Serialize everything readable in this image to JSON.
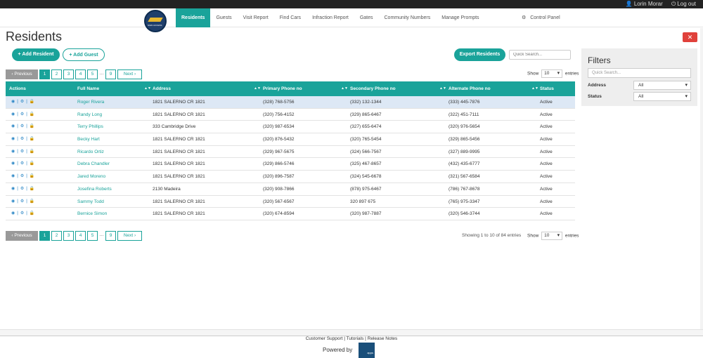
{
  "topbar": {
    "user": "Lorin Morar",
    "logout": "Log out"
  },
  "logo_text": "SIGN ACCESS",
  "nav": {
    "items": [
      "Residents",
      "Guests",
      "Visit Report",
      "Find Cars",
      "Infraction Report",
      "Gates",
      "Community Numbers",
      "Manage Prompts"
    ],
    "active": "Residents",
    "control_panel": "Control Panel"
  },
  "page": {
    "title": "Residents",
    "close": "✕"
  },
  "buttons": {
    "add_resident": "+ Add Resident",
    "add_guest": "+ Add Guest",
    "export": "Export Residents"
  },
  "search": {
    "placeholder": "Quick Search..."
  },
  "pagination": {
    "prev": "‹ Previous",
    "pages": [
      "1",
      "2",
      "3",
      "4",
      "5",
      "…",
      "9"
    ],
    "next": "Next ›",
    "current": "1"
  },
  "show": {
    "label": "Show",
    "value": "10",
    "suffix": "entries"
  },
  "table": {
    "headers": [
      "Actions",
      "Full Name",
      "Address",
      "Primary Phone no",
      "Secondary Phone no",
      "Alternate Phone no",
      "Status"
    ],
    "rows": [
      {
        "name": "Roger Rivera",
        "address": "1821 SALERNO CR 1821",
        "primary": "(328) 768-5756",
        "secondary": "(332) 132-1344",
        "alternate": "(333) 445-7876",
        "status": "Active"
      },
      {
        "name": "Randy Long",
        "address": "1821 SALERNO CR 1821",
        "primary": "(320) 756-4152",
        "secondary": "(329) 865-6467",
        "alternate": "(322) 451-7111",
        "status": "Active"
      },
      {
        "name": "Terry Phillips",
        "address": "333 Cambridge Drive",
        "primary": "(320) 987-6534",
        "secondary": "(327) 655-6474",
        "alternate": "(320) 976-5654",
        "status": "Active"
      },
      {
        "name": "Becky Hart",
        "address": "1821 SALERNO CR 1821",
        "primary": "(320) 876-5432",
        "secondary": "(320) 765-5454",
        "alternate": "(329) 865-5456",
        "status": "Active"
      },
      {
        "name": "Ricardo Ortiz",
        "address": "1821 SALERNO CR 1821",
        "primary": "(329) 967-5675",
        "secondary": "(324) 566-7567",
        "alternate": "(327) 889-9995",
        "status": "Active"
      },
      {
        "name": "Debra Chandler",
        "address": "1821 SALERNO CR 1821",
        "primary": "(329) 866-5746",
        "secondary": "(325) 467-8657",
        "alternate": "(432) 435-6777",
        "status": "Active"
      },
      {
        "name": "Jared Moreno",
        "address": "1821 SALERNO CR 1821",
        "primary": "(320) 896-7587",
        "secondary": "(324) 545-6678",
        "alternate": "(321) 567-6584",
        "status": "Active"
      },
      {
        "name": "Josefina Roberts",
        "address": "2130 Madeira",
        "primary": "(320) 908-7866",
        "secondary": "(878) 975-6467",
        "alternate": "(786) 767-8678",
        "status": "Active"
      },
      {
        "name": "Sammy Todd",
        "address": "1821 SALERNO CR 1821",
        "primary": "(320) 567-6567",
        "secondary": "320 897 675",
        "alternate": "(765) 975-3347",
        "status": "Active"
      },
      {
        "name": "Bernice Simon",
        "address": "1821 SALERNO CR 1821",
        "primary": "(320) 674-8594",
        "secondary": "(320) 987-7887",
        "alternate": "(320) 546-3744",
        "status": "Active"
      }
    ]
  },
  "info": "Showing 1 to 10 of 84 entries",
  "filters": {
    "title": "Filters",
    "search_placeholder": "Quick Search...",
    "address_label": "Address",
    "address_value": "All",
    "status_label": "Status",
    "status_value": "All"
  },
  "footer": {
    "links": "Customer Support | Tutorials | Release Notes",
    "powered_by": "Powered by",
    "logo_text": "apps"
  },
  "colors": {
    "accent": "#1aa39a",
    "danger": "#e0413b"
  },
  "icons": {
    "view": "eye-icon",
    "settings": "gears-icon",
    "lock": "lock-icon"
  }
}
